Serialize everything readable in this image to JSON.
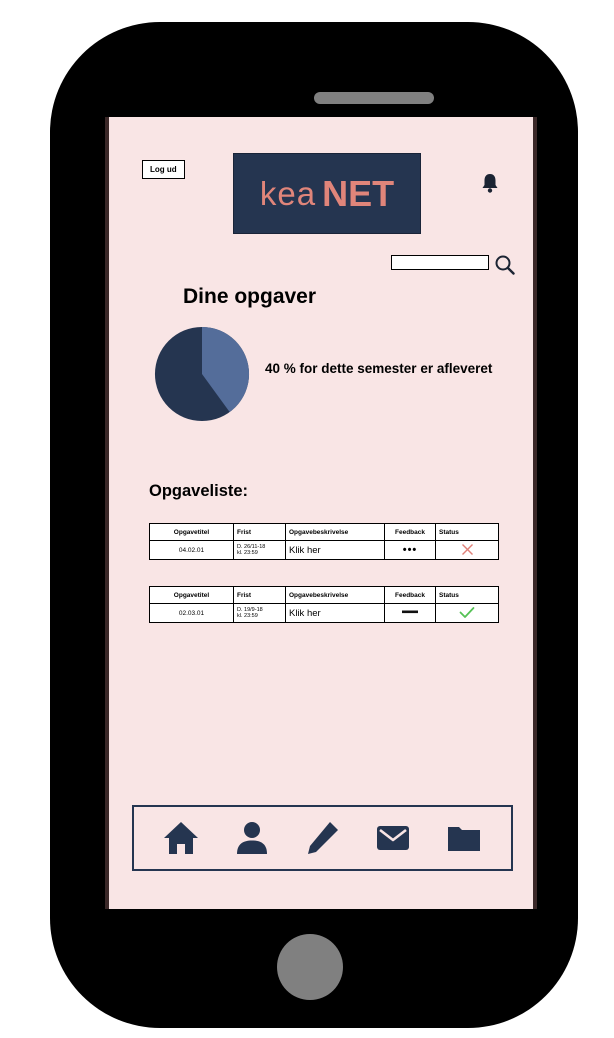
{
  "header": {
    "logout_label": "Log ud",
    "logo_kea": "kea",
    "logo_net": "NET",
    "search_placeholder": ""
  },
  "assignments": {
    "title": "Dine opgaver",
    "progress_percent": 40,
    "progress_text": "40 % for dette semester er afleveret"
  },
  "task_list": {
    "title": "Opgaveliste:",
    "columns": [
      "Opgavetitel",
      "Frist",
      "Opgavebeskrivelse",
      "Feedback",
      "Status"
    ],
    "tasks": [
      {
        "title": "04.02.01",
        "deadline_date": "D. 26/11-18",
        "deadline_time": "kl. 23:59",
        "description_link": "Klik her",
        "feedback": "•••",
        "feedback_icon": "ellipsis",
        "status_icon": "cross-icon"
      },
      {
        "title": "02.03.01",
        "deadline_date": "D. 19/9-18",
        "deadline_time": "kl. 23:59",
        "description_link": "Klik her",
        "feedback": "",
        "feedback_icon": "dash-icon",
        "status_icon": "check-icon"
      }
    ]
  },
  "navigation": [
    "home-icon",
    "user-icon",
    "pencil-icon",
    "mail-icon",
    "folder-icon"
  ],
  "colors": {
    "screen_bg": "#f9e5e5",
    "navy": "#253550",
    "accent": "#e0857a",
    "pie_slice": "#546d9a",
    "pie_base": "#253550",
    "status_fail": "#e08078",
    "status_ok": "#55c255"
  }
}
